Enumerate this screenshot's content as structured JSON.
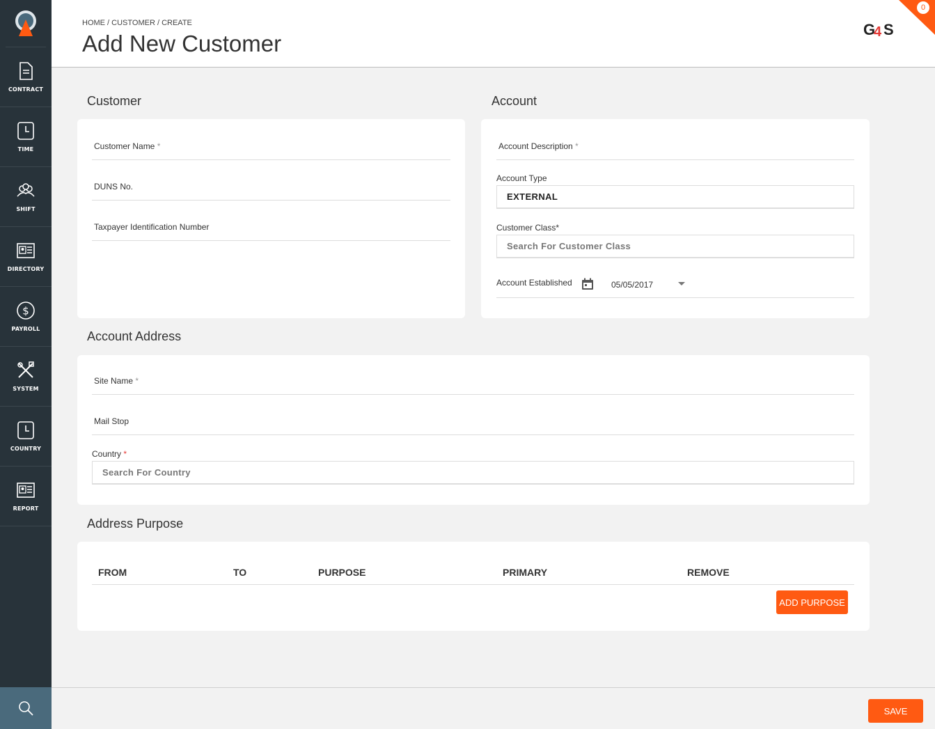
{
  "sidebar": {
    "items": [
      {
        "label": "CONTRACT",
        "icon": "document-icon"
      },
      {
        "label": "TIME",
        "icon": "clock-icon"
      },
      {
        "label": "SHIFT",
        "icon": "people-icon"
      },
      {
        "label": "DIRECTORY",
        "icon": "id-card-icon"
      },
      {
        "label": "PAYROLL",
        "icon": "dollar-icon"
      },
      {
        "label": "SYSTEM",
        "icon": "tools-icon"
      },
      {
        "label": "COUNTRY",
        "icon": "clock-icon"
      },
      {
        "label": "REPORT",
        "icon": "id-card-icon"
      }
    ]
  },
  "header": {
    "breadcrumb": "HOME / CUSTOMER / CREATE",
    "title": "Add New Customer",
    "notification_count": "0"
  },
  "customer": {
    "section_title": "Customer",
    "name_label": "Customer Name",
    "duns_label": "DUNS No.",
    "taxpayer_label": "Taxpayer Identification Number"
  },
  "account": {
    "section_title": "Account",
    "description_label": "Account Description",
    "type_label": "Account Type",
    "type_value": "EXTERNAL",
    "class_label": "Customer Class*",
    "class_placeholder": "Search For Customer Class",
    "established_label": "Account Established",
    "established_value": "05/05/2017"
  },
  "address": {
    "section_title": "Account Address",
    "site_label": "Site Name",
    "mailstop_label": "Mail Stop",
    "country_label": "Country",
    "country_placeholder": "Search For Country"
  },
  "purpose": {
    "section_title": "Address Purpose",
    "columns": [
      "FROM",
      "TO",
      "PURPOSE",
      "PRIMARY",
      "REMOVE"
    ],
    "add_button": "ADD PURPOSE"
  },
  "footer": {
    "save_button": "SAVE"
  },
  "colors": {
    "accent": "#ff5a12",
    "sidebar": "#28333a"
  }
}
